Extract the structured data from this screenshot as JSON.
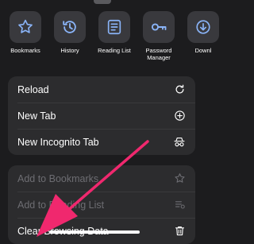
{
  "quick_actions": [
    {
      "label": "Bookmarks",
      "icon": "star-icon"
    },
    {
      "label": "History",
      "icon": "history-icon"
    },
    {
      "label": "Reading List",
      "icon": "reading-list-icon"
    },
    {
      "label": "Password Manager",
      "icon": "key-icon"
    },
    {
      "label": "Downl",
      "icon": "download-icon"
    }
  ],
  "menu_group_1": [
    {
      "label": "Reload",
      "icon": "reload-icon"
    },
    {
      "label": "New Tab",
      "icon": "plus-circle-icon"
    },
    {
      "label": "New Incognito Tab",
      "icon": "incognito-icon"
    }
  ],
  "menu_group_2": [
    {
      "label": "Add to Bookmarks",
      "icon": "star-outline-icon",
      "disabled": true
    },
    {
      "label": "Add to Reading List",
      "icon": "reading-list-add-icon",
      "disabled": true
    },
    {
      "label": "Clear Browsing Data",
      "icon": "trash-icon",
      "disabled": false
    }
  ],
  "colors": {
    "background": "#1c1c1e",
    "group_background": "#2c2c2e",
    "tile_background": "#39393d",
    "accent_blue": "#8ab4f8",
    "annotation_arrow": "#f0286e"
  }
}
